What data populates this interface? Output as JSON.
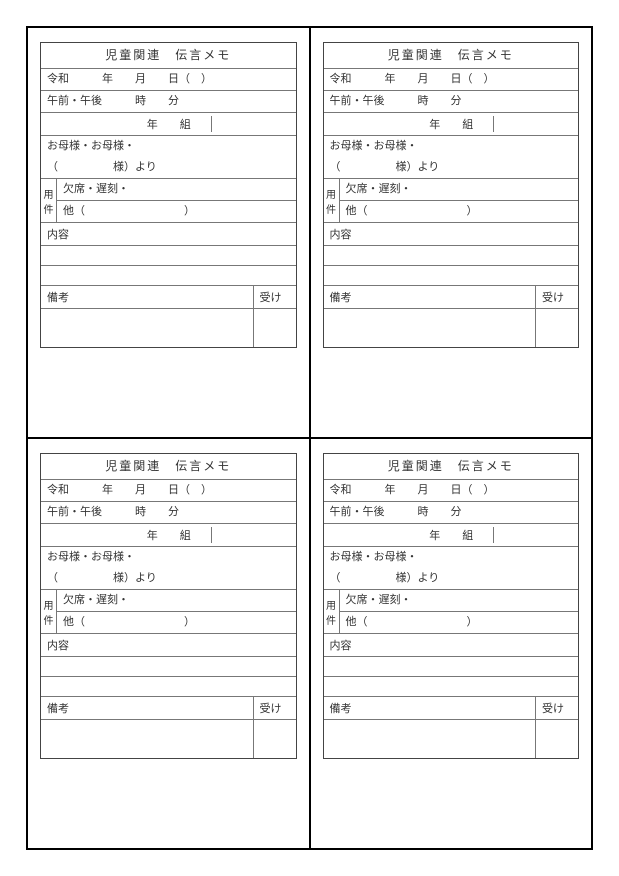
{
  "card": {
    "title": "児童関連　伝言メモ",
    "date_line": "令和　　　年　　月　　日（　）",
    "time_line": "午前・午後　　　時　　分",
    "class_line": "　　年　　組",
    "from_line1": "お母様・お母様・",
    "from_line2": "（　　　　　様）より",
    "yoken_label1": "用",
    "yoken_label2": "件",
    "yoken_line1": "欠席・遅刻・",
    "yoken_line2": "他（　　　　　　　　　）",
    "content_label": "内容",
    "remarks_label": "備考",
    "received_label": "受け"
  }
}
